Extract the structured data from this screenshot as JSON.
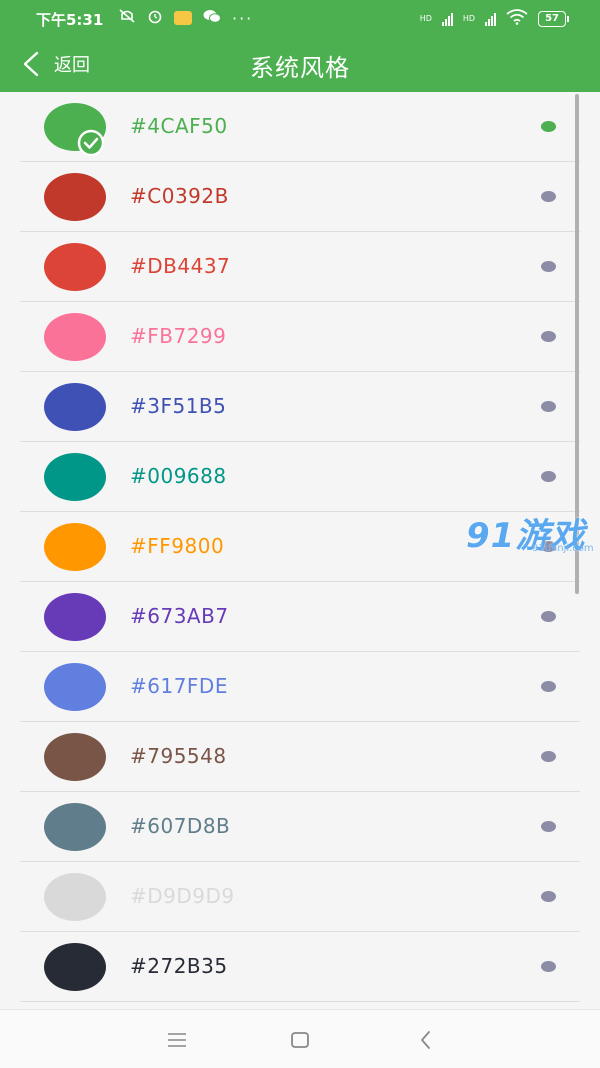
{
  "status_bar": {
    "time": "下午5:31",
    "battery": "57",
    "network_label_1": "HD",
    "network_label_2": "HD",
    "more": "···"
  },
  "header": {
    "back_label": "返回",
    "title": "系统风格"
  },
  "colors": {
    "selected_dot": "#4caf50",
    "unselected_dot": "#8c8ca6",
    "header_bg": "#4caf50"
  },
  "themes": [
    {
      "hex": "#4CAF50",
      "color": "#4CAF50",
      "selected": true
    },
    {
      "hex": "#C0392B",
      "color": "#C0392B",
      "selected": false
    },
    {
      "hex": "#DB4437",
      "color": "#DB4437",
      "selected": false
    },
    {
      "hex": "#FB7299",
      "color": "#FB7299",
      "selected": false
    },
    {
      "hex": "#3F51B5",
      "color": "#3F51B5",
      "selected": false
    },
    {
      "hex": "#009688",
      "color": "#009688",
      "selected": false
    },
    {
      "hex": "#FF9800",
      "color": "#FF9800",
      "selected": false
    },
    {
      "hex": "#673AB7",
      "color": "#673AB7",
      "selected": false
    },
    {
      "hex": "#617FDE",
      "color": "#617FDE",
      "selected": false
    },
    {
      "hex": "#795548",
      "color": "#795548",
      "selected": false
    },
    {
      "hex": "#607D8B",
      "color": "#607D8B",
      "selected": false
    },
    {
      "hex": "#D9D9D9",
      "color": "#D9D9D9",
      "selected": false
    },
    {
      "hex": "#272B35",
      "color": "#272B35",
      "selected": false
    }
  ],
  "watermark": {
    "main": "91游戏",
    "sub": "91danji.com"
  },
  "nav": {
    "menu_icon": "menu-icon",
    "home_icon": "home-icon",
    "back_icon": "back-icon"
  }
}
